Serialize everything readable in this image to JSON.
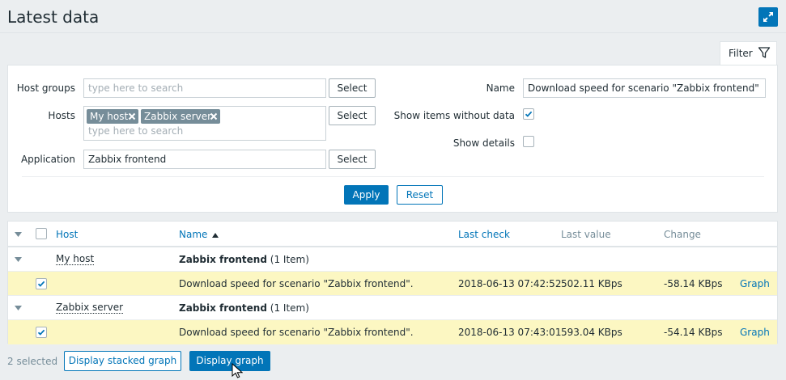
{
  "header": {
    "title": "Latest data",
    "fullscreen_icon": "fullscreen-icon"
  },
  "filter": {
    "tab_label": "Filter",
    "host_groups_label": "Host groups",
    "host_groups_placeholder": "type here to search",
    "hosts_label": "Hosts",
    "hosts_selected": [
      "My host",
      "Zabbix server"
    ],
    "hosts_placeholder": "type here to search",
    "application_label": "Application",
    "application_value": "Zabbix frontend",
    "select_label": "Select",
    "name_label": "Name",
    "name_value": "Download speed for scenario \"Zabbix frontend\"",
    "show_without_data_label": "Show items without data",
    "show_without_data_checked": true,
    "show_details_label": "Show details",
    "show_details_checked": false,
    "apply_label": "Apply",
    "reset_label": "Reset"
  },
  "table": {
    "columns": {
      "host": "Host",
      "name": "Name",
      "last_check": "Last check",
      "last_value": "Last value",
      "change": "Change"
    },
    "groups": [
      {
        "host": "My host",
        "application": "Zabbix frontend",
        "count": "(1 Item)",
        "item": {
          "checked": true,
          "name": "Download speed for scenario \"Zabbix frontend\".",
          "last_check": "2018-06-13 07:42:52",
          "last_value": "502.11 KBps",
          "change": "-58.14 KBps",
          "graph": "Graph"
        }
      },
      {
        "host": "Zabbix server",
        "application": "Zabbix frontend",
        "count": "(1 Item)",
        "item": {
          "checked": true,
          "name": "Download speed for scenario \"Zabbix frontend\".",
          "last_check": "2018-06-13 07:43:01",
          "last_value": "593.04 KBps",
          "change": "-54.14 KBps",
          "graph": "Graph"
        }
      }
    ]
  },
  "footer": {
    "selected": "2 selected",
    "stacked_graph_label": "Display stacked graph",
    "graph_label": "Display graph"
  },
  "colors": {
    "accent": "#0275b8",
    "row_highlight": "#fcf7c2",
    "background": "#ebeef0"
  }
}
